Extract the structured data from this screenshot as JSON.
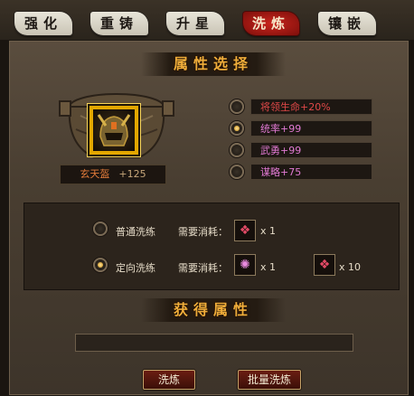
{
  "tabs": [
    {
      "label": "强化",
      "active": false
    },
    {
      "label": "重铸",
      "active": false
    },
    {
      "label": "升星",
      "active": false
    },
    {
      "label": "洗炼",
      "active": true
    },
    {
      "label": "镶嵌",
      "active": false
    }
  ],
  "attr_section": {
    "title": "属性选择",
    "item": {
      "name": "玄天盔",
      "level": "+125"
    },
    "attributes": [
      {
        "text": "将领生命+20%",
        "selected": false,
        "color": "#e04848"
      },
      {
        "text": "统率+99",
        "selected": true,
        "color": "#e27ad4"
      },
      {
        "text": "武勇+99",
        "selected": false,
        "color": "#e27ad4"
      },
      {
        "text": "谋略+75",
        "selected": false,
        "color": "#e27ad4"
      }
    ]
  },
  "options": {
    "normal": {
      "label": "普通洗练",
      "cost_label": "需要消耗：",
      "qty": "x 1",
      "selected": false
    },
    "directed": {
      "label": "定向洗练",
      "cost_label": "需要消耗：",
      "qty1": "x 1",
      "qty2": "x 10",
      "selected": true
    }
  },
  "result_section": {
    "title": "获得属性"
  },
  "buttons": {
    "refine": "洗炼",
    "batch_refine": "批量洗炼"
  },
  "colors": {
    "accent_gold": "#f0ad3a",
    "active_tab": "#b01a14"
  },
  "icons": {
    "helmet": "helmet-icon",
    "cost_item": "refine-stone-icon",
    "target_item": "orb-icon"
  }
}
